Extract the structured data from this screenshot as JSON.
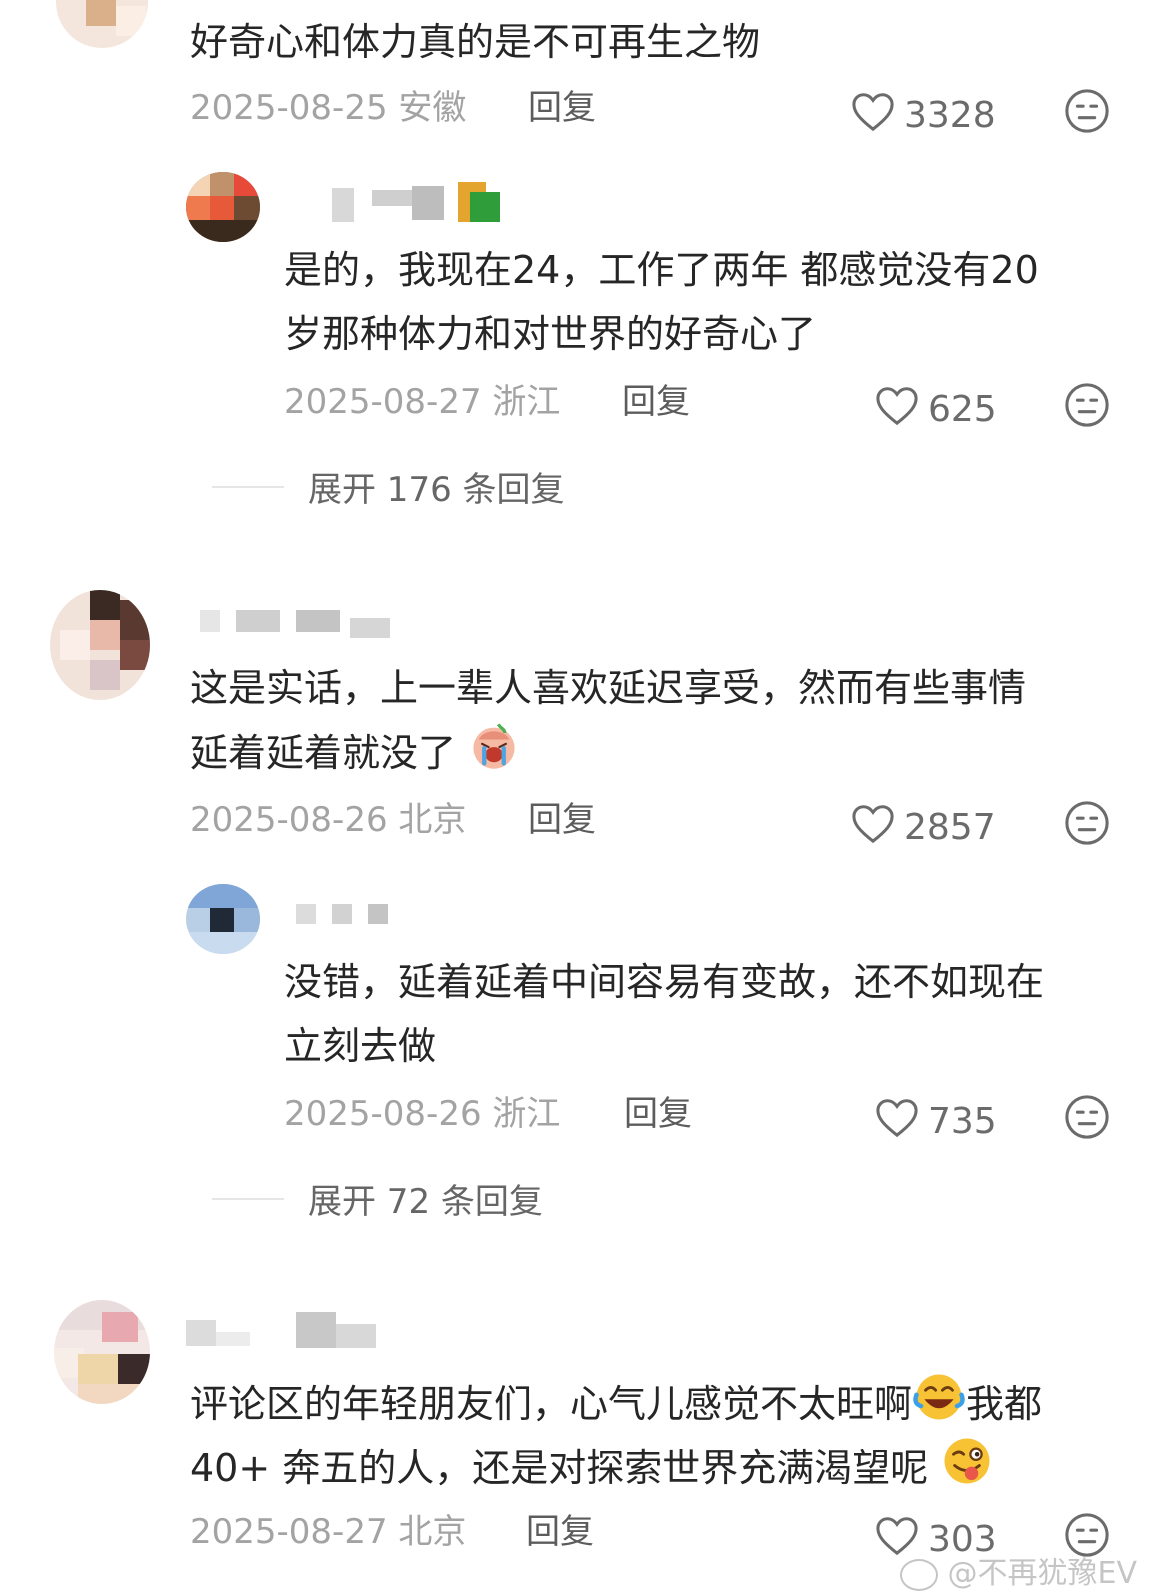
{
  "comments": [
    {
      "text_lines": [
        "好奇心和体力真的是不可再生之物"
      ],
      "date": "2025-08-25",
      "location": "安徽",
      "reply_label": "回复",
      "likes": "3328",
      "reply": {
        "text_lines": [
          "是的，我现在24，工作了两年 都感觉没有20",
          "岁那种体力和对世界的好奇心了"
        ],
        "date": "2025-08-27",
        "location": "浙江",
        "reply_label": "回复",
        "likes": "625"
      },
      "expand_label": "展开 176 条回复"
    },
    {
      "text_lines": [
        "这是实话，上一辈人喜欢延迟享受，然而有些事情",
        "延着延着就没了"
      ],
      "emoji": "crying-face-icon",
      "date": "2025-08-26",
      "location": "北京",
      "reply_label": "回复",
      "likes": "2857",
      "reply": {
        "text_lines": [
          "没错，延着延着中间容易有变故，还不如现在",
          "立刻去做"
        ],
        "date": "2025-08-26",
        "location": "浙江",
        "reply_label": "回复",
        "likes": "735"
      },
      "expand_label": "展开 72 条回复"
    },
    {
      "text_lines": [
        "评论区的年轻朋友们，心气儿感觉不太旺啊",
        "我都",
        "40+ 奔五的人，还是对探索世界充满渴望呢"
      ],
      "emojis": [
        "laughing-tears-icon",
        "winking-tongue-icon"
      ],
      "date": "2025-08-27",
      "location": "北京",
      "reply_label": "回复",
      "likes": "303"
    }
  ],
  "watermark": "@不再犹豫EV",
  "colors": {
    "text": "#262626",
    "meta": "#a3a3a3",
    "reply": "#5c5c5c",
    "icon": "#6b6b6b"
  }
}
